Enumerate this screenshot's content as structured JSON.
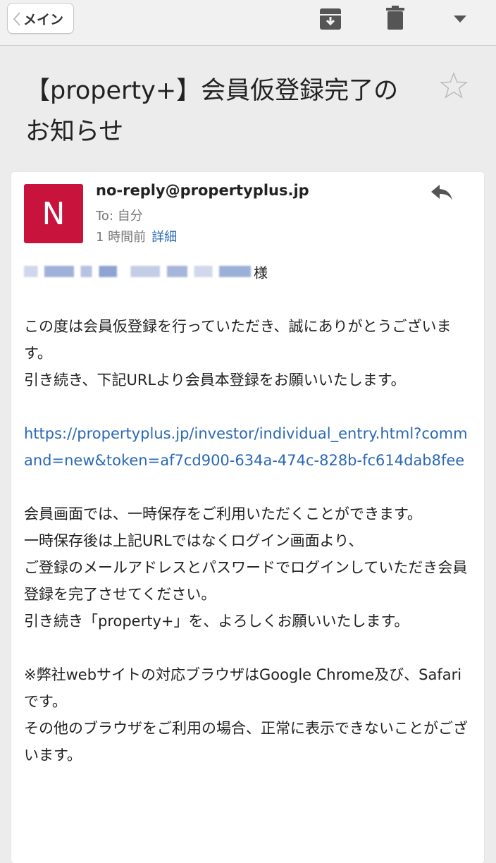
{
  "toolbar": {
    "back_label": "メイン"
  },
  "subject": {
    "text": "【property+】会員仮登録完了のお知らせ"
  },
  "message": {
    "avatar_letter": "N",
    "sender": "no-reply@propertyplus.jp",
    "to": "To: 自分",
    "time": "1 時間前",
    "details_label": "詳細",
    "recipient_suffix": "様",
    "paragraphs": {
      "p1_l1": "この度は会員仮登録を行っていただき、誠にありがとうございます。",
      "p1_l2": "引き続き、下記URLより会員本登録をお願いいたします。",
      "link": "https://propertyplus.jp/investor/individual_entry.html?command=new&token=af7cd900-634a-474c-828b-fc614dab8fee",
      "p2_l1": "会員画面では、一時保存をご利用いただくことができます。",
      "p2_l2": "一時保存後は上記URLではなくログイン画面より、",
      "p2_l3": "ご登録のメールアドレスとパスワードでログインしていただき会員登録を完了させてください。",
      "p2_l4": "引き続き「property+」を、よろしくお願いいたします。",
      "p3_l1": "※弊社webサイトの対応ブラウザはGoogle Chrome及び、Safariです。",
      "p3_l2": "その他のブラウザをご利用の場合、正常に表示できないことがございます。"
    }
  },
  "colors": {
    "avatar_bg": "#c8143c",
    "link": "#2a68b6",
    "background": "#ececec"
  },
  "icons": [
    "chevron-left-icon",
    "archive-icon",
    "trash-icon",
    "dropdown-caret-icon",
    "star-icon",
    "reply-icon"
  ]
}
